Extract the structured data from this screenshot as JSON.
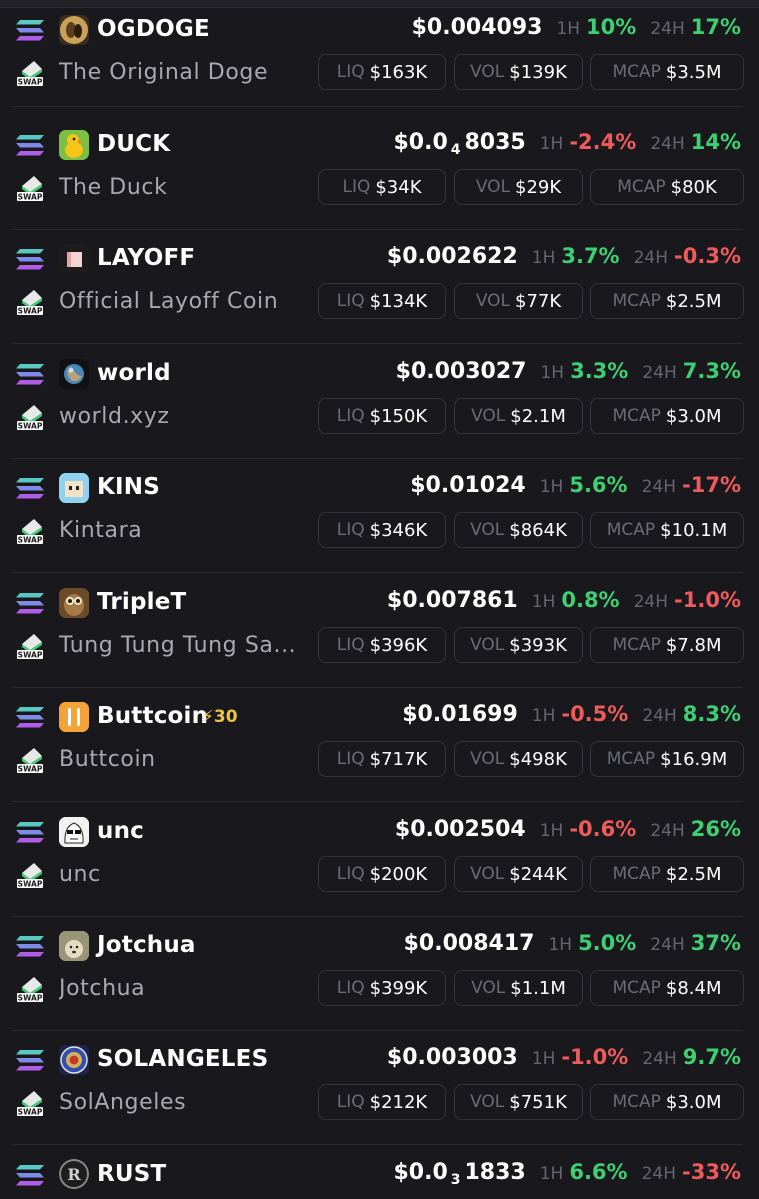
{
  "labels": {
    "h1": "1H",
    "h24": "24H",
    "liq": "LIQ",
    "vol": "VOL",
    "mcap": "MCAP",
    "swap": "SWAP"
  },
  "colors": {
    "positive": "#3ecf72",
    "negative": "#ef5b5b",
    "badge": "#f0c43d"
  },
  "tokens": [
    {
      "ticker": "OGDOGE",
      "name": "The Original Doge",
      "logo": "doge-icon",
      "price": "$0.004093",
      "change_1h": "10%",
      "change_1h_dir": "pos",
      "change_24h": "17%",
      "change_24h_dir": "pos",
      "liq": "$163K",
      "vol": "$139K",
      "mcap": "$3.5M"
    },
    {
      "ticker": "DUCK",
      "name": "The Duck",
      "logo": "duck-icon",
      "price_prefix": "$0.0",
      "price_zeros": "4",
      "price_digits": "8035",
      "change_1h": "-2.4%",
      "change_1h_dir": "neg",
      "change_24h": "14%",
      "change_24h_dir": "pos",
      "liq": "$34K",
      "vol": "$29K",
      "mcap": "$80K"
    },
    {
      "ticker": "LAYOFF",
      "name": "Official Layoff Coin",
      "logo": "paper-icon",
      "price": "$0.002622",
      "change_1h": "3.7%",
      "change_1h_dir": "pos",
      "change_24h": "-0.3%",
      "change_24h_dir": "neg",
      "liq": "$134K",
      "vol": "$77K",
      "mcap": "$2.5M"
    },
    {
      "ticker": "world",
      "name": "world.xyz",
      "logo": "globe-icon",
      "price": "$0.003027",
      "change_1h": "3.3%",
      "change_1h_dir": "pos",
      "change_24h": "7.3%",
      "change_24h_dir": "pos",
      "liq": "$150K",
      "vol": "$2.1M",
      "mcap": "$3.0M"
    },
    {
      "ticker": "KINS",
      "name": "Kintara",
      "logo": "pixel-face-icon",
      "price": "$0.01024",
      "change_1h": "5.6%",
      "change_1h_dir": "pos",
      "change_24h": "-17%",
      "change_24h_dir": "neg",
      "liq": "$346K",
      "vol": "$864K",
      "mcap": "$10.1M"
    },
    {
      "ticker": "TripleT",
      "name": "Tung Tung Tung Sa...",
      "logo": "owl-icon",
      "price": "$0.007861",
      "change_1h": "0.8%",
      "change_1h_dir": "pos",
      "change_24h": "-1.0%",
      "change_24h_dir": "neg",
      "liq": "$396K",
      "vol": "$393K",
      "mcap": "$7.8M"
    },
    {
      "ticker": "Buttcoin",
      "badge": "⚡30",
      "name": "Buttcoin",
      "logo": "buttcoin-icon",
      "price": "$0.01699",
      "change_1h": "-0.5%",
      "change_1h_dir": "neg",
      "change_24h": "8.3%",
      "change_24h_dir": "pos",
      "liq": "$717K",
      "vol": "$498K",
      "mcap": "$16.9M"
    },
    {
      "ticker": "unc",
      "name": "unc",
      "logo": "sunglasses-face-icon",
      "price": "$0.002504",
      "change_1h": "-0.6%",
      "change_1h_dir": "neg",
      "change_24h": "26%",
      "change_24h_dir": "pos",
      "liq": "$200K",
      "vol": "$244K",
      "mcap": "$2.5M"
    },
    {
      "ticker": "Jotchua",
      "name": "Jotchua",
      "logo": "dog-photo-icon",
      "price": "$0.008417",
      "change_1h": "5.0%",
      "change_1h_dir": "pos",
      "change_24h": "37%",
      "change_24h_dir": "pos",
      "liq": "$399K",
      "vol": "$1.1M",
      "mcap": "$8.4M"
    },
    {
      "ticker": "SOLANGELES",
      "name": "SolAngeles",
      "logo": "emblem-icon",
      "price": "$0.003003",
      "change_1h": "-1.0%",
      "change_1h_dir": "neg",
      "change_24h": "9.7%",
      "change_24h_dir": "pos",
      "liq": "$212K",
      "vol": "$751K",
      "mcap": "$3.0M"
    },
    {
      "ticker": "RUST",
      "name": "",
      "logo": "rust-coin-icon",
      "price_prefix": "$0.0",
      "price_zeros": "3",
      "price_digits": "1833",
      "change_1h": "6.6%",
      "change_1h_dir": "pos",
      "change_24h": "-33%",
      "change_24h_dir": "neg",
      "liq": "",
      "vol": "",
      "mcap": ""
    }
  ]
}
